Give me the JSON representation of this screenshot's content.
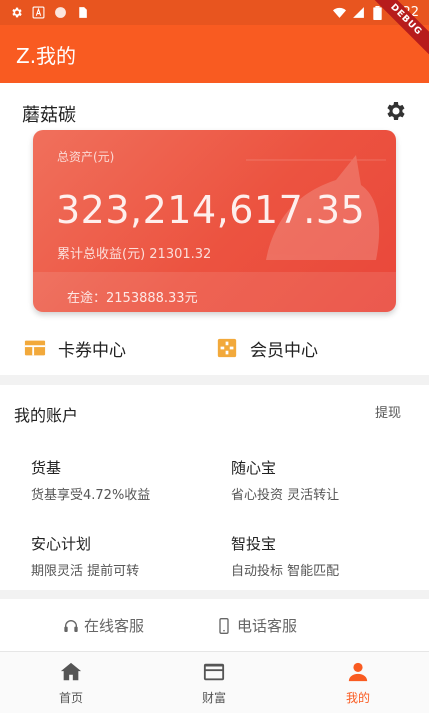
{
  "statusbar": {
    "time": "9:22"
  },
  "debug_ribbon": "DEBUG",
  "appbar": {
    "title": "Z.我的"
  },
  "profile": {
    "username": "蘑菇碳",
    "card": {
      "label": "总资产(元)",
      "amount": "323,214,617.35",
      "earnings": "累计总收益(元) 21301.32",
      "in_transit": "在途：2153888.33元"
    },
    "quick_links": [
      {
        "label": "卡券中心",
        "icon": "card-voucher-icon"
      },
      {
        "label": "会员中心",
        "icon": "member-center-icon"
      }
    ]
  },
  "account": {
    "title": "我的账户",
    "withdraw": "提现",
    "items": [
      {
        "name": "货基",
        "desc": "货基享受4.72%收益"
      },
      {
        "name": "随心宝",
        "desc": "省心投资 灵活转让"
      },
      {
        "name": "安心计划",
        "desc": "期限灵活 提前可转"
      },
      {
        "name": "智投宝",
        "desc": "自动投标 智能匹配"
      }
    ]
  },
  "service": {
    "online": "在线客服",
    "phone": "电话客服"
  },
  "nav": [
    {
      "label": "首页",
      "icon": "home-icon"
    },
    {
      "label": "财富",
      "icon": "wallet-card-icon"
    },
    {
      "label": "我的",
      "icon": "person-icon",
      "active": true
    }
  ],
  "colors": {
    "accent": "#f95b21",
    "card": "#ec5340"
  }
}
